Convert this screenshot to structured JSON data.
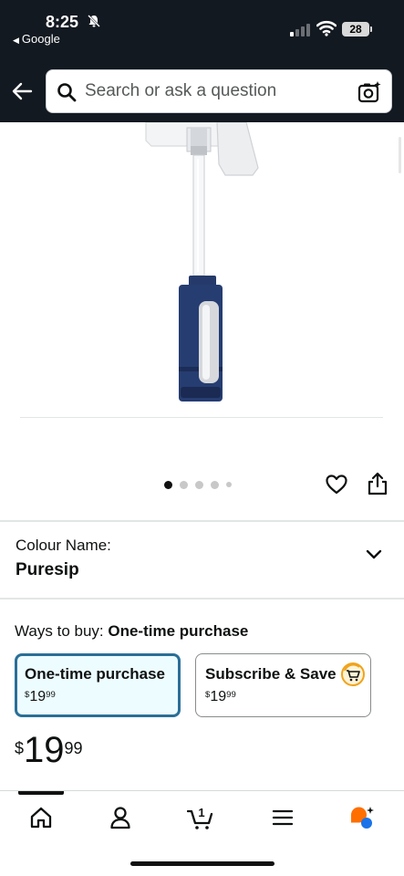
{
  "status_bar": {
    "time": "8:25",
    "back_app": "Google",
    "battery": "28"
  },
  "header": {
    "search_placeholder": "Search or ask a question"
  },
  "product": {
    "image_count": 5,
    "active_image": 1
  },
  "colour": {
    "label": "Colour Name:",
    "value": "Puresip"
  },
  "ways_to_buy": {
    "label": "Ways to buy: ",
    "selected": "One-time purchase",
    "options": [
      {
        "title": "One-time purchase",
        "currency": "$",
        "whole": "19",
        "cents": "99"
      },
      {
        "title": "Subscribe & Save",
        "currency": "$",
        "whole": "19",
        "cents": "99"
      }
    ]
  },
  "price": {
    "currency": "$",
    "whole": "19",
    "cents": "99"
  },
  "bottom_nav": {
    "items": [
      "home-icon",
      "account-icon",
      "cart-icon",
      "menu-icon",
      "rufus-icon"
    ],
    "cart_count": "1"
  },
  "colors": {
    "header_bg": "#131921",
    "selected_border": "#2a6f97",
    "selected_bg": "#edfdff",
    "rufus_orange": "#ff6f00",
    "rufus_blue": "#1a73e8"
  }
}
